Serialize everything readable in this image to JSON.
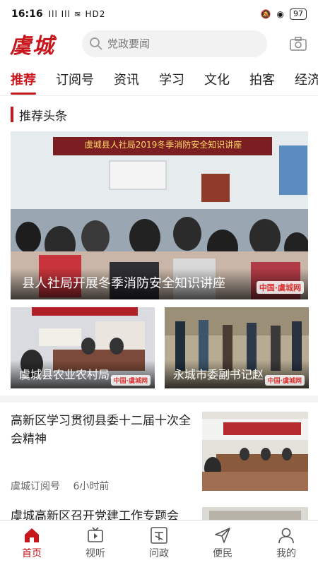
{
  "status_bar": {
    "time": "16:16",
    "signal": "Ill Ill ≋ HD2",
    "battery": "97"
  },
  "header": {
    "logo": "虞城",
    "search_placeholder": "党政要闻"
  },
  "tabs": [
    "推荐",
    "订阅号",
    "资讯",
    "学习",
    "文化",
    "拍客",
    "经济"
  ],
  "section": {
    "title": "推荐头条"
  },
  "hero": {
    "caption": "县人社局开展冬季消防安全知识讲座",
    "banner": "虞城县人社局2019冬季消防安全知识讲座",
    "watermark": "中国·虞城网"
  },
  "cards": [
    {
      "caption": "虞城县农业农村局…",
      "watermark": "中国·虞城网"
    },
    {
      "caption": "永城市委副书记赵…",
      "watermark": "中国·虞城网"
    }
  ],
  "news": [
    {
      "title": "高新区学习贯彻县委十二届十次全会精神",
      "source": "虞城订阅号",
      "time": "6小时前"
    },
    {
      "title": "虞城高新区召开党建工作专题会"
    }
  ],
  "bottom_nav": [
    {
      "label": "首页",
      "icon": "home-icon"
    },
    {
      "label": "视听",
      "icon": "tv-icon"
    },
    {
      "label": "问政",
      "icon": "politics-icon"
    },
    {
      "label": "便民",
      "icon": "send-icon"
    },
    {
      "label": "我的",
      "icon": "profile-icon"
    }
  ],
  "colors": {
    "accent": "#c8161d"
  }
}
